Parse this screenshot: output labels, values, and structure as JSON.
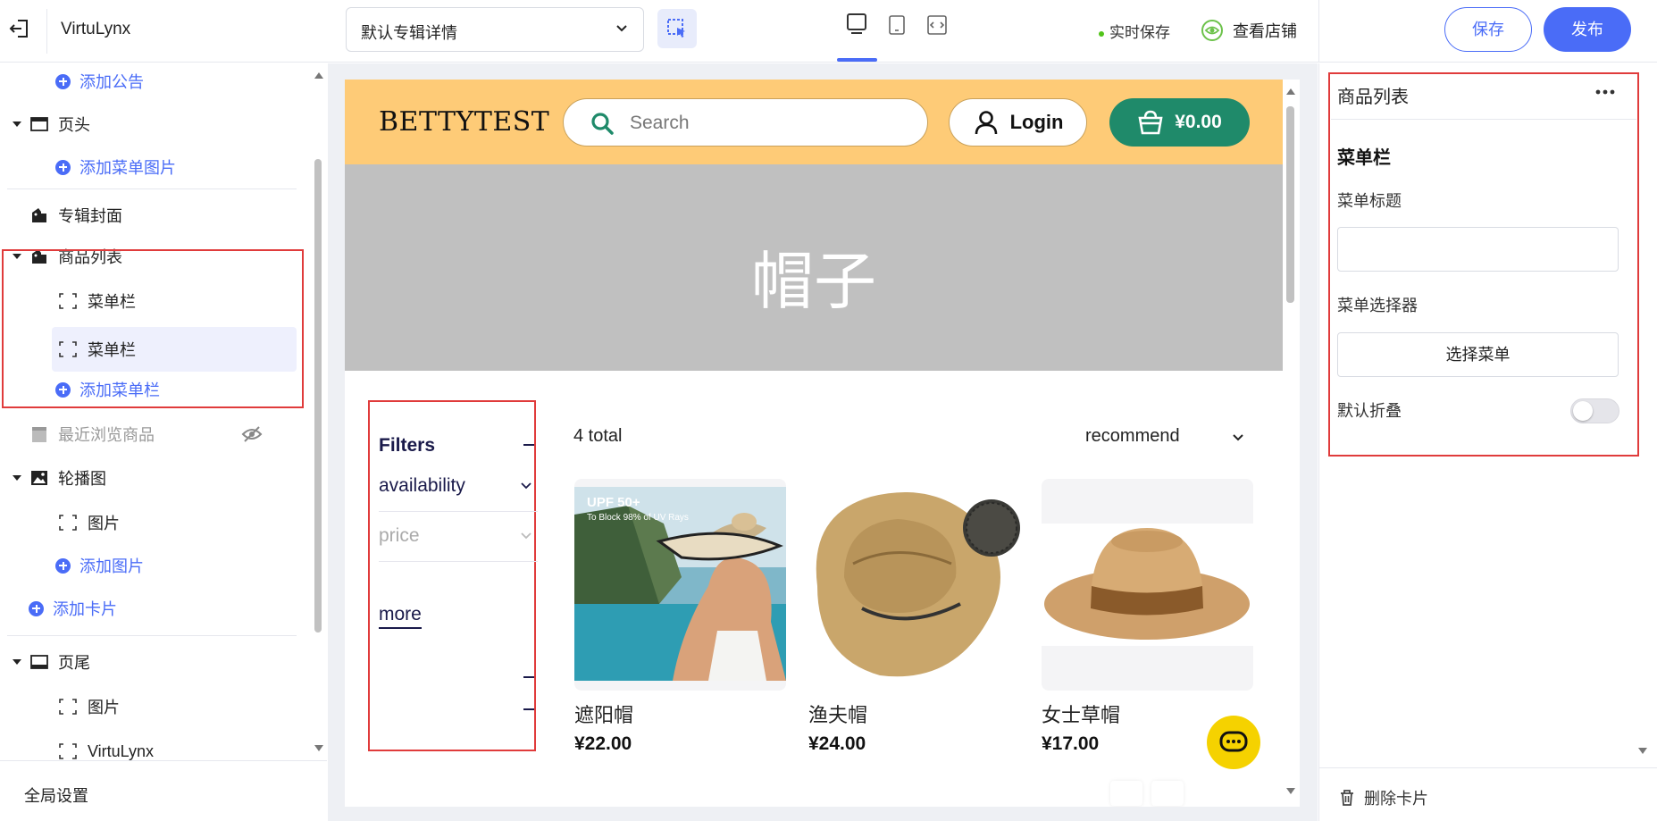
{
  "app": {
    "title": "VirtuLynx"
  },
  "toolbar": {
    "template_value": "默认专辑详情",
    "autosave_label": "实时保存",
    "view_store_label": "查看店铺",
    "save_label": "保存",
    "publish_label": "发布",
    "selected_device": "desktop"
  },
  "sidebar": {
    "items": [
      {
        "label": "添加公告",
        "type": "add"
      },
      {
        "label": "页头",
        "type": "section"
      },
      {
        "label": "添加菜单图片",
        "type": "add"
      },
      {
        "label": "专辑封面",
        "type": "section"
      },
      {
        "label": "商品列表",
        "type": "section"
      },
      {
        "label": "菜单栏",
        "type": "block"
      },
      {
        "label": "菜单栏",
        "type": "block",
        "selected": true
      },
      {
        "label": "添加菜单栏",
        "type": "add"
      },
      {
        "label": "最近浏览商品",
        "type": "section",
        "hidden": true
      },
      {
        "label": "轮播图",
        "type": "section"
      },
      {
        "label": "图片",
        "type": "block"
      },
      {
        "label": "添加图片",
        "type": "add"
      },
      {
        "label": "添加卡片",
        "type": "add"
      },
      {
        "label": "页尾",
        "type": "section"
      },
      {
        "label": "图片",
        "type": "block"
      },
      {
        "label": "VirtuLynx",
        "type": "block"
      }
    ],
    "footer_label": "全局设置"
  },
  "preview": {
    "brand": "BETTYTEST",
    "search_placeholder": "Search",
    "login_label": "Login",
    "cart_total": "¥0.00",
    "banner_title": "帽子",
    "filters": {
      "title": "Filters",
      "items": [
        "availability",
        "price"
      ],
      "more_label": "more"
    },
    "total_label": "4 total",
    "sort_label": "recommend",
    "products": [
      {
        "name": "遮阳帽",
        "price": "¥22.00",
        "image_text": "UPF 50+",
        "image_subtext": "To Block 98% of UV Rays"
      },
      {
        "name": "渔夫帽",
        "price": "¥24.00"
      },
      {
        "name": "女士草帽",
        "price": "¥17.00"
      }
    ]
  },
  "inspector": {
    "title": "商品列表",
    "section_heading": "菜单栏",
    "menu_title_label": "菜单标题",
    "menu_title_value": "",
    "menu_selector_label": "菜单选择器",
    "select_menu_label": "选择菜单",
    "default_collapse_label": "默认折叠",
    "default_collapse_on": false,
    "delete_label": "删除卡片"
  },
  "colors": {
    "accent": "#4a6cf7",
    "header_bg": "#fecb77",
    "cart_bg": "#1f8a6a",
    "banner_bg": "#c0c0c0",
    "highlight_outline": "#e03b3b",
    "chat_fab": "#f5d200"
  }
}
